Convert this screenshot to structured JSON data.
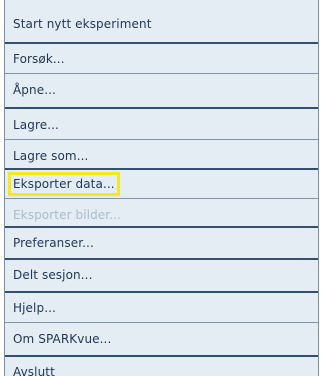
{
  "menu": {
    "items": [
      {
        "label": "Start nytt eksperiment",
        "disabled": false
      },
      {
        "label": "Forsøk...",
        "disabled": false
      },
      {
        "label": "Åpne...",
        "disabled": false
      },
      {
        "label": "Lagre...",
        "disabled": false
      },
      {
        "label": "Lagre som...",
        "disabled": false
      },
      {
        "label": "Eksporter data...",
        "disabled": false,
        "highlighted": true
      },
      {
        "label": "Eksporter bilder...",
        "disabled": true
      },
      {
        "label": "Preferanser...",
        "disabled": false
      },
      {
        "label": "Delt sesjon...",
        "disabled": false
      },
      {
        "label": "Hjelp...",
        "disabled": false
      },
      {
        "label": "Om SPARKvue...",
        "disabled": false
      },
      {
        "label": "Avslutt",
        "disabled": false
      }
    ]
  },
  "colors": {
    "menu_background": "#e5edf4",
    "text": "#1f3557",
    "disabled_text": "#a9bbcd",
    "highlight": "#f7e81a"
  }
}
